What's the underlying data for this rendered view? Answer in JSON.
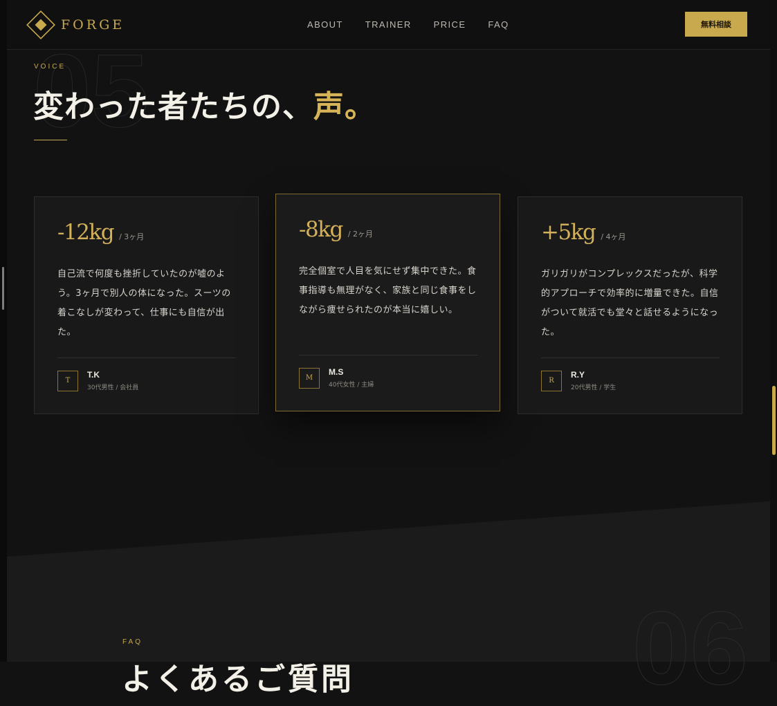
{
  "header": {
    "logo_text": "FORGE",
    "nav": [
      "ABOUT",
      "TRAINER",
      "PRICE",
      "FAQ"
    ],
    "cta_label": "無料相談"
  },
  "voice": {
    "bg_number": "05",
    "eyebrow": "VOICE",
    "title_main": "変わった者たちの、",
    "title_accent": "声。",
    "cards": [
      {
        "value": "-12kg",
        "period": "/ 3ヶ月",
        "quote": "自己流で何度も挫折していたのが嘘のよう。3ヶ月で別人の体になった。スーツの着こなしが変わって、仕事にも自信が出た。",
        "initial": "T",
        "name": "T.K",
        "meta": "30代男性 / 会社員"
      },
      {
        "value": "-8kg",
        "period": "/ 2ヶ月",
        "quote": "完全個室で人目を気にせず集中できた。食事指導も無理がなく、家族と同じ食事をしながら痩せられたのが本当に嬉しい。",
        "initial": "M",
        "name": "M.S",
        "meta": "40代女性 / 主婦"
      },
      {
        "value": "+5kg",
        "period": "/ 4ヶ月",
        "quote": "ガリガリがコンプレックスだったが、科学的アプローチで効率的に増量できた。自信がついて就活でも堂々と話せるようになった。",
        "initial": "R",
        "name": "R.Y",
        "meta": "20代男性 / 学生"
      }
    ]
  },
  "faq": {
    "bg_number": "06",
    "eyebrow": "FAQ",
    "title": "よくあるご質問"
  },
  "colors": {
    "accent": "#c9a94e",
    "background": "#121212",
    "card": "#191919"
  }
}
